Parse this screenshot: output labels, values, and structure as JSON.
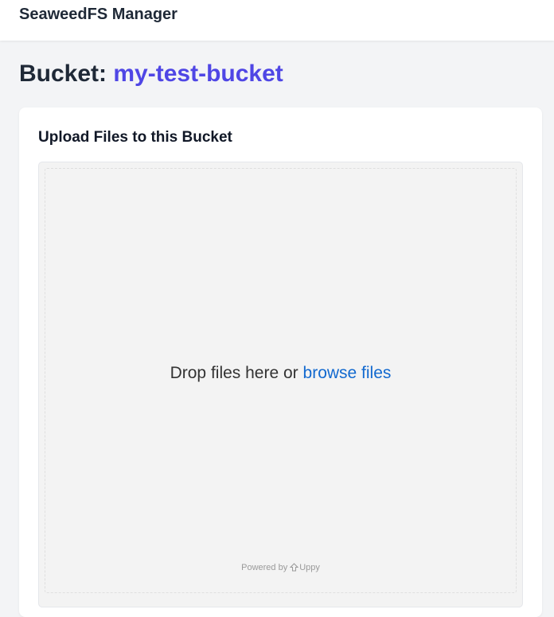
{
  "navbar": {
    "brand": "SeaweedFS Manager"
  },
  "page": {
    "title_prefix": "Bucket:",
    "bucket_name": "my-test-bucket"
  },
  "upload_card": {
    "title": "Upload Files to this Bucket",
    "drop_text": "Drop files here or",
    "browse_label": "browse files",
    "powered_by": "Powered by",
    "powered_brand": "Uppy"
  },
  "colors": {
    "accent": "#4f46e5",
    "link": "#1269cf",
    "background": "#f3f4f6"
  }
}
